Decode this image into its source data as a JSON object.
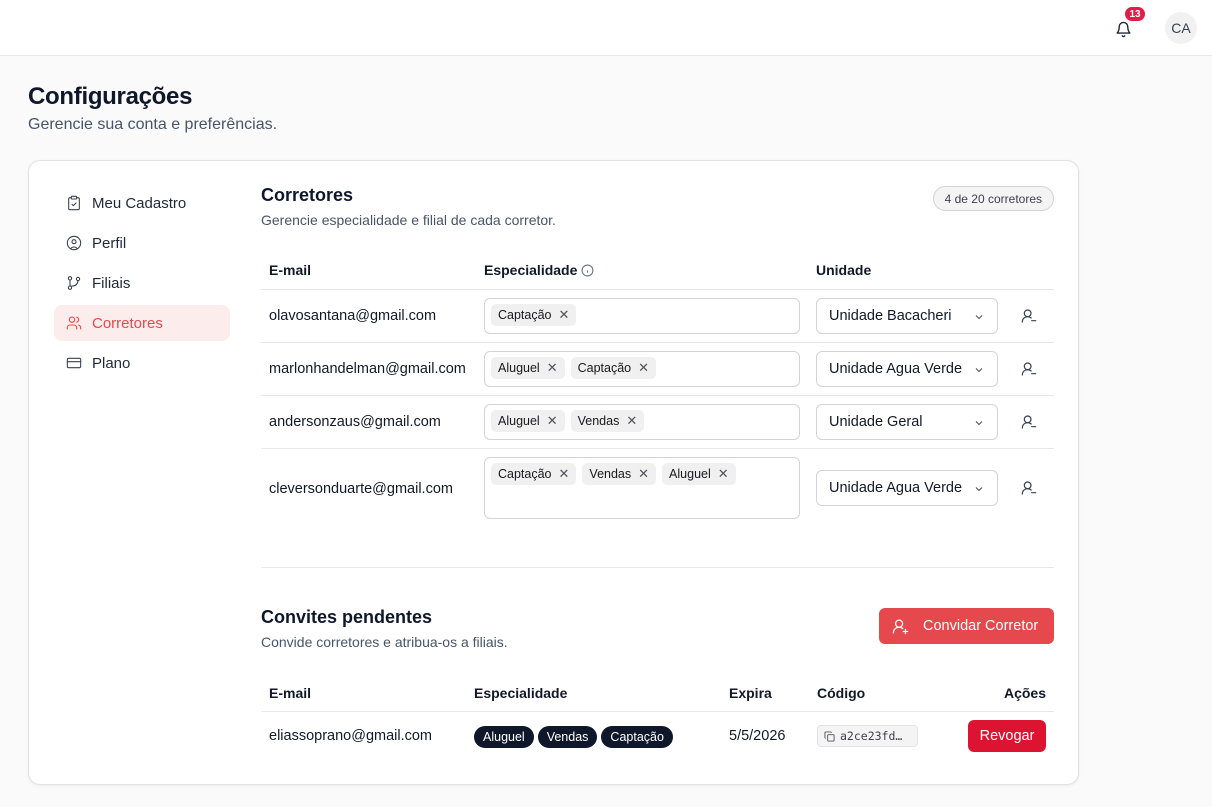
{
  "topbar": {
    "notifications_count": "13",
    "avatar_initials": "CA"
  },
  "page": {
    "title": "Configurações",
    "subtitle": "Gerencie sua conta e preferências."
  },
  "nav": {
    "items": [
      {
        "label": "Meu Cadastro",
        "icon": "clipboard-icon"
      },
      {
        "label": "Perfil",
        "icon": "user-circle-icon"
      },
      {
        "label": "Filiais",
        "icon": "git-branch-icon"
      },
      {
        "label": "Corretores",
        "icon": "users-icon",
        "active": true
      },
      {
        "label": "Plano",
        "icon": "credit-card-icon"
      }
    ]
  },
  "brokers": {
    "title": "Corretores",
    "subtitle": "Gerencie especialidade e filial de cada corretor.",
    "count_label": "4 de 20 corretores",
    "columns": {
      "email": "E-mail",
      "specialty": "Especialidade",
      "unit": "Unidade"
    },
    "rows": [
      {
        "email": "olavosantana@gmail.com",
        "specialties": [
          "Captação"
        ],
        "unit": "Unidade Bacacheri"
      },
      {
        "email": "marlonhandelman@gmail.com",
        "specialties": [
          "Aluguel",
          "Captação"
        ],
        "unit": "Unidade Agua Verde"
      },
      {
        "email": "andersonzaus@gmail.com",
        "specialties": [
          "Aluguel",
          "Vendas"
        ],
        "unit": "Unidade Geral"
      },
      {
        "email": "cleversonduarte@gmail.com",
        "specialties": [
          "Captação",
          "Vendas",
          "Aluguel"
        ],
        "unit": "Unidade Agua Verde"
      }
    ]
  },
  "invites": {
    "title": "Convites pendentes",
    "subtitle": "Convide corretores e atribua-os a filiais.",
    "invite_button": "Convidar Corretor",
    "columns": {
      "email": "E-mail",
      "specialty": "Especialidade",
      "expires": "Expira",
      "code": "Código",
      "actions": "Ações"
    },
    "rows": [
      {
        "email": "eliassoprano@gmail.com",
        "specialties": [
          "Aluguel",
          "Vendas",
          "Captação"
        ],
        "expires": "5/5/2026",
        "code": "a2ce23fd…",
        "action": "Revogar"
      }
    ]
  },
  "colors": {
    "accent": "#e5484d",
    "danger": "#dc1431",
    "badge_dark": "#0f172a"
  }
}
